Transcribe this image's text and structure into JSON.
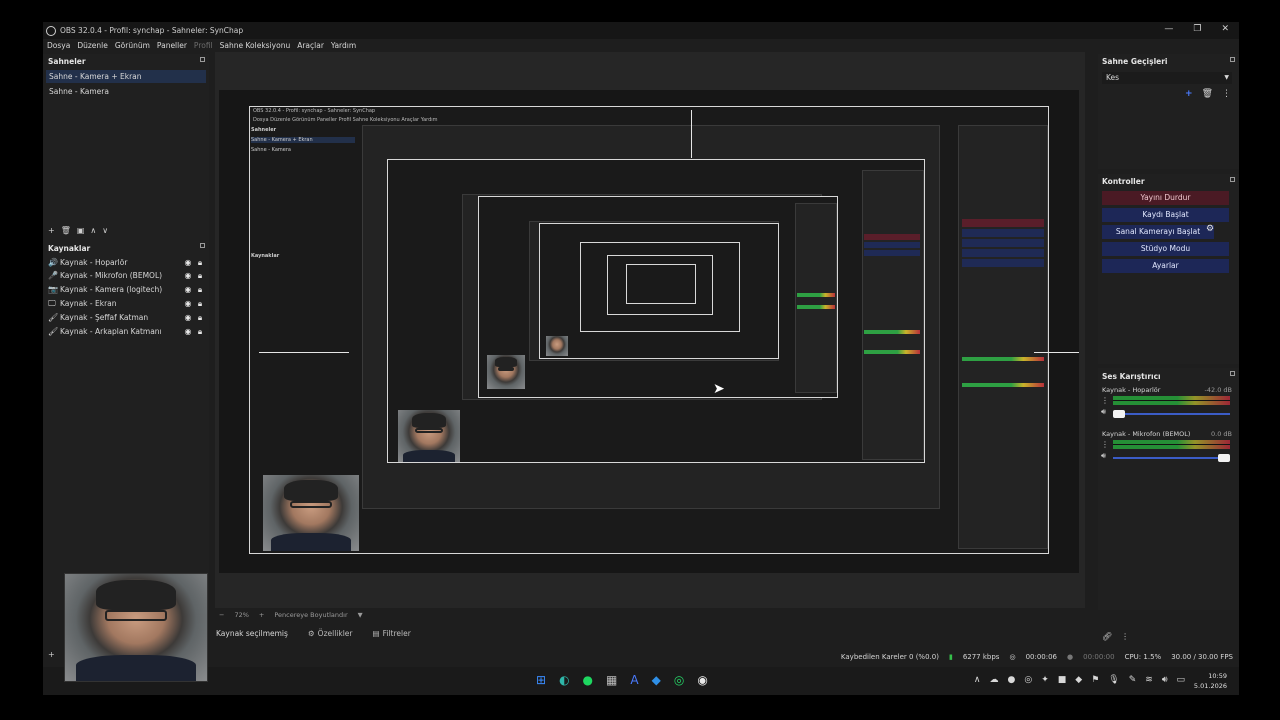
{
  "window": {
    "title": "OBS 32.0.4 - Profil: synchap - Sahneler: SynChap",
    "controls": [
      "—",
      "❐",
      "✕"
    ]
  },
  "menu": [
    "Dosya",
    "Düzenle",
    "Görünüm",
    "Paneller",
    "Profil",
    "Sahne Koleksiyonu",
    "Araçlar",
    "Yardım"
  ],
  "scenes": {
    "title": "Sahneler",
    "items": [
      "Sahne - Kamera + Ekran",
      "Sahne - Kamera"
    ],
    "tools": [
      "+",
      "🗑",
      "▣",
      "∧",
      "∨"
    ]
  },
  "sources": {
    "title": "Kaynaklar",
    "items": [
      {
        "icon": "🔊",
        "label": "Kaynak - Hoparlör"
      },
      {
        "icon": "🎤",
        "label": "Kaynak - Mikrofon (BEMOL)"
      },
      {
        "icon": "📷",
        "label": "Kaynak - Kamera (logitech)"
      },
      {
        "icon": "🖵",
        "label": "Kaynak - Ekran"
      },
      {
        "icon": "🖌",
        "label": "Kaynak - Şeffaf Katman"
      },
      {
        "icon": "🖌",
        "label": "Kaynak - Arkaplan Katmanı"
      }
    ]
  },
  "preview": {
    "zoom": "72%",
    "fit": "Pencereye Boyutlandır",
    "nested_title": "OBS 32.0.4 - Profil: synchap - Sahneler: SynChap",
    "nested_menu": "Dosya  Düzenle  Görünüm  Paneller  Profil  Sahne Koleksiyonu  Araçlar  Yardım",
    "nested_scenes_title": "Sahneler",
    "nested_scene1": "Sahne - Kamera + Ekran",
    "nested_scene2": "Sahne - Kamera",
    "nested_sources_title": "Kaynaklar"
  },
  "context": {
    "no_source": "Kaynak seçilmemiş",
    "properties": "Özellikler",
    "filters": "Filtreler"
  },
  "transitions": {
    "title": "Sahne Geçişleri",
    "selected": "Kes"
  },
  "controls": {
    "title": "Kontroller",
    "stop_stream": "Yayını Durdur",
    "start_record": "Kaydı Başlat",
    "start_virtualcam": "Sanal Kamerayı Başlat",
    "studio_mode": "Stüdyo Modu",
    "settings": "Ayarlar"
  },
  "mixer": {
    "title": "Ses Karıştırıcı",
    "channels": [
      {
        "name": "Kaynak - Hoparlör",
        "db": "-42.0 dB",
        "level": 0.08
      },
      {
        "name": "Kaynak - Mikrofon (BEMOL)",
        "db": "0.0 dB",
        "level": 1.0
      }
    ]
  },
  "status": {
    "dropped": "Kaybedilen Kareler 0 (%0.0)",
    "bitrate": "6277 kbps",
    "stream_time": "00:00:06",
    "record_time": "00:00:00",
    "cpu": "CPU: 1.5%",
    "fps": "30.00 / 30.00 FPS"
  },
  "taskbar": {
    "time": "10:59",
    "date": "5.01.2026"
  },
  "colors": {
    "accent": "#4a7bff",
    "stream_active": "#4a1a24",
    "button_blue": "#1d2757",
    "selection": "#22304a"
  }
}
